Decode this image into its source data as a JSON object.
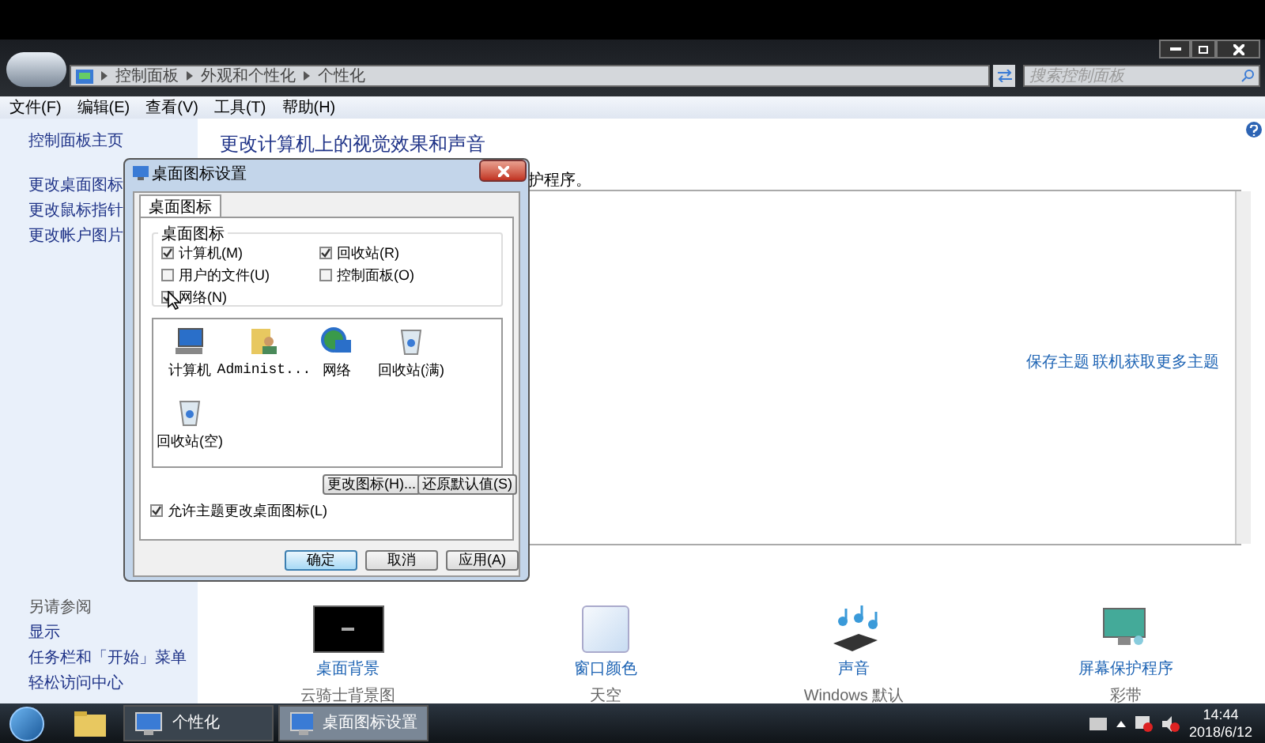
{
  "window": {
    "breadcrumb": [
      "控制面板",
      "外观和个性化",
      "个性化"
    ],
    "search": {
      "placeholder": "搜索控制面板"
    }
  },
  "menu": [
    "文件(F)",
    "编辑(E)",
    "查看(V)",
    "工具(T)",
    "帮助(H)"
  ],
  "sidebar": {
    "items": [
      "控制面板主页",
      "更改桌面图标",
      "更改鼠标指针",
      "更改帐户图片"
    ],
    "see_also_title": "另请参阅",
    "see_also": [
      "显示",
      "任务栏和「开始」菜单",
      "轻松访问中心"
    ]
  },
  "main": {
    "heading": "更改计算机上的视觉效果和声音",
    "subtitle_visible": "护程序。",
    "theme_links": [
      "保存主题",
      "联机获取更多主题"
    ],
    "settings": [
      {
        "kind": "background",
        "label": "桌面背景",
        "value": "云骑士背景图"
      },
      {
        "kind": "color",
        "label": "窗口颜色",
        "value": "天空"
      },
      {
        "kind": "sound",
        "label": "声音",
        "value": "Windows 默认"
      },
      {
        "kind": "screensaver",
        "label": "屏幕保护程序",
        "value": "彩带"
      }
    ]
  },
  "dialog": {
    "title": "桌面图标设置",
    "tabs": [
      {
        "label": "桌面图标",
        "selected": true
      }
    ],
    "group_title": "桌面图标",
    "checkboxes": [
      {
        "label": "计算机(M)",
        "checked": true
      },
      {
        "label": "回收站(R)",
        "checked": true
      },
      {
        "label": "用户的文件(U)",
        "checked": false
      },
      {
        "label": "控制面板(O)",
        "checked": false
      },
      {
        "label": "网络(N)",
        "checked": true
      }
    ],
    "icons": [
      {
        "kind": "computer",
        "label": "计算机"
      },
      {
        "kind": "user",
        "label": "Administ..."
      },
      {
        "kind": "network",
        "label": "网络"
      },
      {
        "kind": "bin",
        "label": "回收站(满)"
      },
      {
        "kind": "bin",
        "label": "回收站(空)"
      }
    ],
    "icon_buttons": [
      "更改图标(H)...",
      "还原默认值(S)"
    ],
    "allow_themes": {
      "label": "允许主题更改桌面图标(L)",
      "checked": true
    },
    "buttons": [
      {
        "label": "确定",
        "default": true
      },
      {
        "label": "取消",
        "default": false
      },
      {
        "label": "应用(A)",
        "default": false
      }
    ]
  },
  "taskbar": {
    "buttons": [
      {
        "label": "个性化",
        "selected": false
      },
      {
        "label": "桌面图标设置",
        "selected": true
      }
    ],
    "time": "14:44",
    "date": "2018/6/12"
  }
}
